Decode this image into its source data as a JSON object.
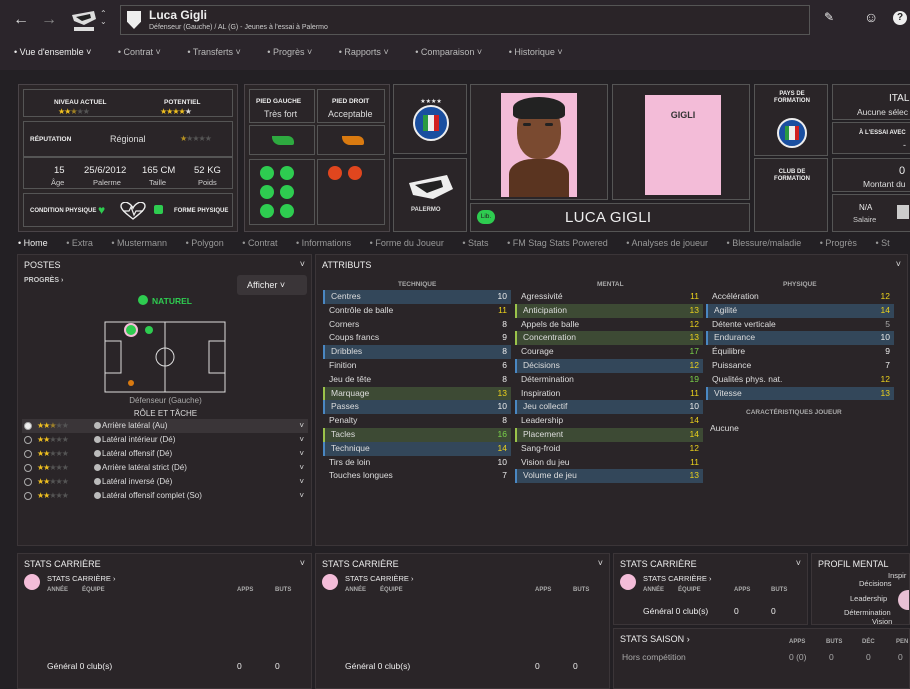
{
  "header": {
    "name": "Luca Gigli",
    "subtitle": "Défenseur (Gauche) / AL (G) - Jeunes à l'essai à Palermo"
  },
  "menu": [
    "Vue d'ensemble",
    "Contrat",
    "Transferts",
    "Progrès",
    "Rapports",
    "Comparaison",
    "Historique"
  ],
  "info": {
    "current_level_label": "NIVEAU ACTUEL",
    "potential_label": "POTENTIEL",
    "current_stars": 2.5,
    "potential_stars": 4.5,
    "reputation_label": "RÉPUTATION",
    "reputation_value": "Régional",
    "reputation_stars": 0.5,
    "age_value": "15",
    "age_label": "Âge",
    "dob_value": "25/6/2012",
    "dob_place": "Palerme",
    "height_value": "165 CM",
    "height_label": "Taille",
    "weight_value": "52 KG",
    "weight_label": "Poids",
    "condition_label": "CONDITION PHYSIQUE",
    "form_label": "FORME PHYSIQUE"
  },
  "feet": {
    "left_label": "PIED GAUCHE",
    "left_value": "Très fort",
    "right_label": "PIED DROIT",
    "right_value": "Acceptable"
  },
  "club_badge_text": "PALERMO",
  "shirt_name": "GIGLI",
  "portrait_name": "LUCA GIGLI",
  "portrait_badge": "Lib.",
  "formation": {
    "country_label": "PAYS DE FORMATION",
    "club_label": "CLUB DE FORMATION"
  },
  "right_info": {
    "nat_value": "ITAL",
    "nat_sub": "Aucune sélec",
    "trial_label": "À L'ESSAI AVEC",
    "trial_value": "-",
    "amount_value": "0",
    "amount_label": "Montant du",
    "salary_value": "N/A",
    "salary_label": "Salaire"
  },
  "tabs": [
    "Home",
    "Extra",
    "Mustermann",
    "Polygon",
    "Contrat",
    "Informations",
    "Forme du Joueur",
    "Stats",
    "FM Stag Stats Powered",
    "Analyses de joueur",
    "Blessure/maladie",
    "Progrès",
    "St"
  ],
  "positions": {
    "title": "POSTES",
    "progress_link": "PROGRÈS",
    "show_button": "Afficher",
    "natural_label": "NATUREL",
    "position_caption": "Défenseur (Gauche)",
    "roles_title": "RÔLE ET TÂCHE",
    "roles": [
      {
        "name": "Arrière latéral (Au)",
        "stars": 2.5
      },
      {
        "name": "Latéral intérieur (Dé)",
        "stars": 2
      },
      {
        "name": "Latéral offensif (Dé)",
        "stars": 2
      },
      {
        "name": "Arrière latéral strict (Dé)",
        "stars": 2
      },
      {
        "name": "Latéral inversé (Dé)",
        "stars": 2
      },
      {
        "name": "Latéral offensif complet (So)",
        "stars": 2
      }
    ]
  },
  "attributes": {
    "title": "ATTRIBUTS",
    "technique_title": "TECHNIQUE",
    "mental_title": "MENTAL",
    "physique_title": "PHYSIQUE",
    "traits_title": "CARACTÉRISTIQUES JOUEUR",
    "traits_value": "Aucune",
    "technique": [
      {
        "n": "Centres",
        "v": "10",
        "h": "b"
      },
      {
        "n": "Contrôle de balle",
        "v": "11",
        "h": ""
      },
      {
        "n": "Corners",
        "v": "8",
        "h": ""
      },
      {
        "n": "Coups francs",
        "v": "9",
        "h": ""
      },
      {
        "n": "Dribbles",
        "v": "8",
        "h": "b"
      },
      {
        "n": "Finition",
        "v": "6",
        "h": ""
      },
      {
        "n": "Jeu de tête",
        "v": "8",
        "h": ""
      },
      {
        "n": "Marquage",
        "v": "13",
        "h": "g"
      },
      {
        "n": "Passes",
        "v": "10",
        "h": "b"
      },
      {
        "n": "Penalty",
        "v": "8",
        "h": ""
      },
      {
        "n": "Tacles",
        "v": "16",
        "h": "g"
      },
      {
        "n": "Technique",
        "v": "14",
        "h": "b"
      },
      {
        "n": "Tirs de loin",
        "v": "10",
        "h": ""
      },
      {
        "n": "Touches longues",
        "v": "7",
        "h": ""
      }
    ],
    "mental": [
      {
        "n": "Agressivité",
        "v": "11",
        "h": ""
      },
      {
        "n": "Anticipation",
        "v": "13",
        "h": "g"
      },
      {
        "n": "Appels de balle",
        "v": "12",
        "h": ""
      },
      {
        "n": "Concentration",
        "v": "13",
        "h": "g"
      },
      {
        "n": "Courage",
        "v": "17",
        "h": ""
      },
      {
        "n": "Décisions",
        "v": "12",
        "h": "b"
      },
      {
        "n": "Détermination",
        "v": "19",
        "h": ""
      },
      {
        "n": "Inspiration",
        "v": "11",
        "h": ""
      },
      {
        "n": "Jeu collectif",
        "v": "10",
        "h": "b"
      },
      {
        "n": "Leadership",
        "v": "14",
        "h": ""
      },
      {
        "n": "Placement",
        "v": "14",
        "h": "g"
      },
      {
        "n": "Sang-froid",
        "v": "12",
        "h": ""
      },
      {
        "n": "Vision du jeu",
        "v": "11",
        "h": ""
      },
      {
        "n": "Volume de jeu",
        "v": "13",
        "h": "b"
      }
    ],
    "physique": [
      {
        "n": "Accélération",
        "v": "12",
        "h": ""
      },
      {
        "n": "Agilité",
        "v": "14",
        "h": "b"
      },
      {
        "n": "Détente verticale",
        "v": "5",
        "h": ""
      },
      {
        "n": "Endurance",
        "v": "10",
        "h": "b"
      },
      {
        "n": "Équilibre",
        "v": "9",
        "h": ""
      },
      {
        "n": "Puissance",
        "v": "7",
        "h": ""
      },
      {
        "n": "Qualités phys. nat.",
        "v": "12",
        "h": ""
      },
      {
        "n": "Vitesse",
        "v": "13",
        "h": "b"
      }
    ]
  },
  "career": {
    "title": "STATS CARRIÈRE",
    "link": "STATS CARRIÈRE",
    "col_year": "ANNÉE",
    "col_team": "ÉQUIPE",
    "col_apps": "APPS",
    "col_goals": "BUTS",
    "total_label": "Général 0 club(s)",
    "total_apps": "0",
    "total_goals": "0"
  },
  "season": {
    "title": "STATS SAISON",
    "col_apps": "APPS",
    "col_goals": "BUTS",
    "col_dec": "DÉC",
    "col_pen": "PEN",
    "row_label": "Hors compétition",
    "row_apps": "0 (0)",
    "row_goals": "0",
    "row_dec": "0",
    "row_pen": "0"
  },
  "mental_profile": {
    "title": "PROFIL MENTAL",
    "labels": [
      "Inspir",
      "Décisions",
      "Leadership",
      "Détermination",
      "Vision"
    ]
  },
  "colors": {
    "bg": "#232024",
    "yellow": "#ecd21c",
    "green_accent": "#2ecc50",
    "blue_highlight": "#33475a",
    "green_highlight": "#3d4a34",
    "pink": "#f3bcd8"
  }
}
